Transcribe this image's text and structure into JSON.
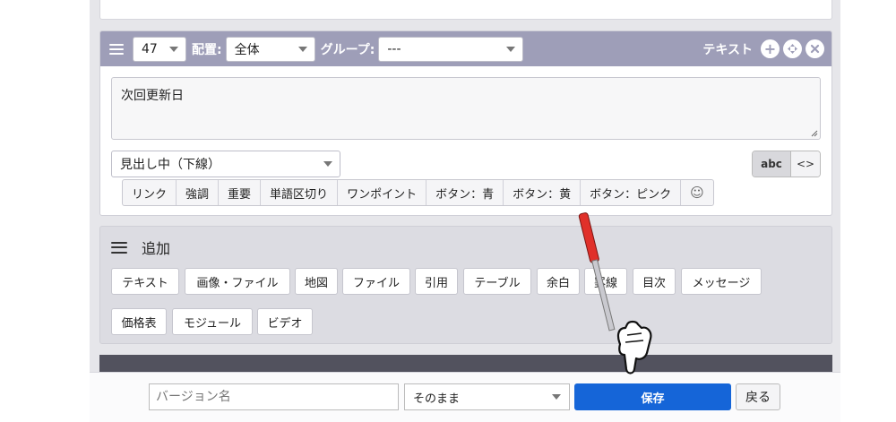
{
  "block": {
    "number": "47",
    "placement_label": "配置:",
    "placement_value": "全体",
    "group_label": "グループ:",
    "group_value": "---",
    "type_label": "テキスト",
    "text_content": "次回更新日",
    "style_value": "見出し中（下線）",
    "mode_abc": "abc",
    "mode_code": "<>",
    "format_buttons": [
      "リンク",
      "強調",
      "重要",
      "単語区切り",
      "ワンポイント",
      "ボタン：青",
      "ボタン：黄",
      "ボタン：ピンク",
      "☺"
    ]
  },
  "add_panel": {
    "title": "追加",
    "buttons": [
      "テキスト",
      "画像・ファイル",
      "地図",
      "ファイル",
      "引用",
      "テーブル",
      "余白",
      "罫線",
      "目次",
      "メッセージ",
      "価格表",
      "モジュール",
      "ビデオ"
    ]
  },
  "bottom_bar": {
    "version_placeholder": "バージョン名",
    "keep_value": "そのまま",
    "save_label": "保存",
    "back_label": "戻る"
  },
  "colors": {
    "header": "#9e9eb8",
    "save_button": "#1565d8",
    "pointer_red": "#e0302a"
  }
}
